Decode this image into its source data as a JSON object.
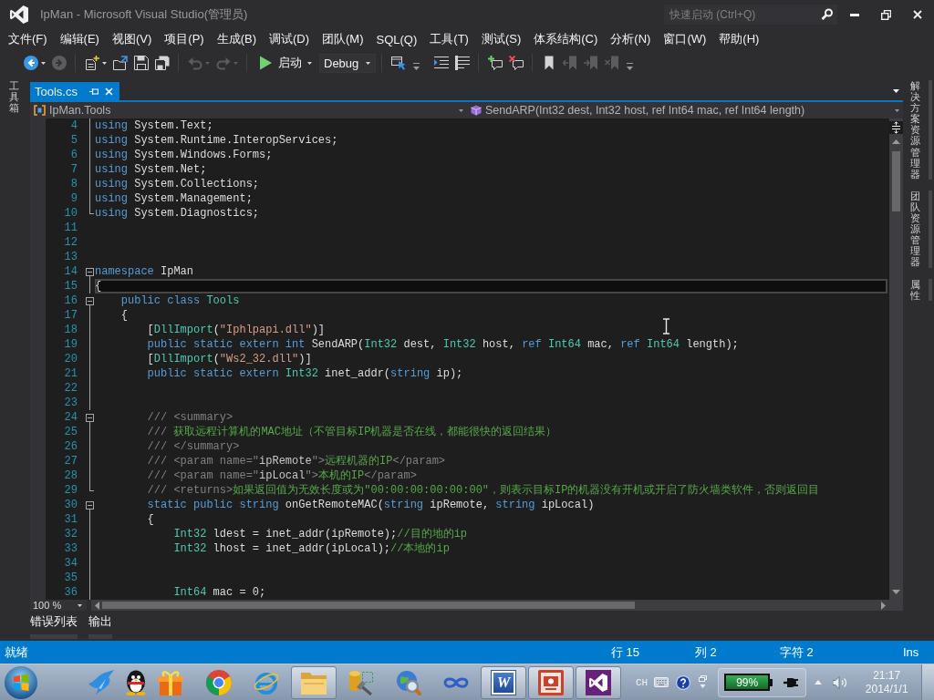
{
  "title_bar": {
    "title": "IpMan - Microsoft Visual Studio(管理员)",
    "quick_launch": {
      "placeholder": "快速启动 (Ctrl+Q)"
    }
  },
  "menu": [
    "文件(F)",
    "编辑(E)",
    "视图(V)",
    "项目(P)",
    "生成(B)",
    "调试(D)",
    "团队(M)",
    "SQL(Q)",
    "工具(T)",
    "测试(S)",
    "体系结构(C)",
    "分析(N)",
    "窗口(W)",
    "帮助(H)"
  ],
  "toolbars": [
    {
      "groups": [
        [
          {
            "kind": "back",
            "disabled": false,
            "dropdown": true
          },
          {
            "kind": "forward",
            "disabled": true,
            "dropdown": false
          }
        ],
        [
          {
            "kind": "new",
            "disabled": false,
            "dropdown": true
          },
          {
            "kind": "open",
            "disabled": false,
            "dropdown": false
          },
          {
            "kind": "save",
            "disabled": false,
            "dropdown": false
          },
          {
            "kind": "saveall",
            "disabled": false,
            "dropdown": false
          }
        ],
        [
          {
            "kind": "undo",
            "disabled": true,
            "dropdown": true
          },
          {
            "kind": "redo",
            "disabled": true,
            "dropdown": true
          }
        ],
        [
          {
            "kind": "run",
            "label": "启动",
            "disabled": false,
            "dropdown": true
          },
          {
            "kind": "combo",
            "value": "Debug",
            "disabled": false,
            "dropdown": true
          }
        ],
        [
          {
            "kind": "attach",
            "disabled": false,
            "dropdown": false
          }
        ]
      ]
    },
    {
      "groups": [
        [
          {
            "kind": "indent",
            "disabled": false,
            "dropdown": false
          },
          {
            "kind": "outdent",
            "disabled": false,
            "dropdown": false
          }
        ],
        [
          {
            "kind": "comment",
            "disabled": false,
            "dropdown": false
          },
          {
            "kind": "uncomment",
            "disabled": false,
            "dropdown": false
          }
        ],
        [
          {
            "kind": "bookmark",
            "disabled": false,
            "dropdown": false
          },
          {
            "kind": "prevmark",
            "disabled": true,
            "dropdown": false
          },
          {
            "kind": "nextmark",
            "disabled": true,
            "dropdown": false
          },
          {
            "kind": "clearmark",
            "disabled": true,
            "dropdown": false
          }
        ]
      ]
    }
  ],
  "left_tabs": [
    "工具箱"
  ],
  "document_tabs": [
    {
      "label": "Tools.cs",
      "selected": true
    }
  ],
  "navigation": {
    "type": "IpMan.Tools",
    "member": "SendARP(Int32 dest, Int32 host, ref Int64 mac, ref Int64 length)"
  },
  "editor": {
    "lines": [
      {
        "number": "4",
        "kind": "inside",
        "current": false,
        "tokens": [
          {
            "kind": "keyword",
            "text": "using"
          },
          {
            "kind": "plain",
            "text": " System.Text;"
          }
        ]
      },
      {
        "number": "5",
        "kind": "inside",
        "current": false,
        "tokens": [
          {
            "kind": "keyword",
            "text": "using"
          },
          {
            "kind": "plain",
            "text": " System.Runtime.InteropServices;"
          }
        ]
      },
      {
        "number": "6",
        "kind": "inside",
        "current": false,
        "tokens": [
          {
            "kind": "keyword",
            "text": "using"
          },
          {
            "kind": "plain",
            "text": " System.Windows.Forms;"
          }
        ]
      },
      {
        "number": "7",
        "kind": "inside",
        "current": false,
        "tokens": [
          {
            "kind": "keyword",
            "text": "using"
          },
          {
            "kind": "plain",
            "text": " System.Net;"
          }
        ]
      },
      {
        "number": "8",
        "kind": "inside",
        "current": false,
        "tokens": [
          {
            "kind": "keyword",
            "text": "using"
          },
          {
            "kind": "plain",
            "text": " System.Collections;"
          }
        ]
      },
      {
        "number": "9",
        "kind": "inside",
        "current": false,
        "tokens": [
          {
            "kind": "keyword",
            "text": "using"
          },
          {
            "kind": "plain",
            "text": " System.Management;"
          }
        ]
      },
      {
        "number": "10",
        "kind": "end",
        "current": false,
        "tokens": [
          {
            "kind": "keyword",
            "text": "using"
          },
          {
            "kind": "plain",
            "text": " System.Diagnostics;"
          }
        ]
      },
      {
        "number": "11",
        "kind": "outside",
        "current": false
      },
      {
        "number": "12",
        "kind": "outside",
        "current": false
      },
      {
        "number": "13",
        "kind": "outside",
        "current": false
      },
      {
        "number": "14",
        "kind": "start",
        "current": false,
        "tokens": [
          {
            "kind": "keyword",
            "text": "namespace"
          },
          {
            "kind": "plain",
            "text": " IpMan"
          }
        ]
      },
      {
        "number": "15",
        "kind": "inside",
        "current": true,
        "tokens": [
          {
            "kind": "plain",
            "text": "{"
          }
        ]
      },
      {
        "number": "16",
        "kind": "start",
        "current": false,
        "tokens": [
          {
            "kind": "keyword",
            "text": "    public class"
          },
          {
            "kind": "type",
            "text": " Tools"
          }
        ]
      },
      {
        "number": "17",
        "kind": "inside",
        "current": false,
        "tokens": [
          {
            "kind": "plain",
            "text": "    {"
          }
        ]
      },
      {
        "number": "18",
        "kind": "inside",
        "current": false,
        "tokens": [
          {
            "kind": "plain",
            "text": "        ["
          },
          {
            "kind": "type",
            "text": "DllImport"
          },
          {
            "kind": "plain",
            "text": "("
          },
          {
            "kind": "string",
            "text": "\"Iphlpapi.dll\""
          },
          {
            "kind": "plain",
            "text": ")]"
          }
        ]
      },
      {
        "number": "19",
        "kind": "inside",
        "current": false,
        "tokens": [
          {
            "kind": "keyword",
            "text": "        public static extern int"
          },
          {
            "kind": "plain",
            "text": " SendARP("
          },
          {
            "kind": "type",
            "text": "Int32"
          },
          {
            "kind": "plain",
            "text": " dest, "
          },
          {
            "kind": "type",
            "text": "Int32"
          },
          {
            "kind": "plain",
            "text": " host, "
          },
          {
            "kind": "keyword",
            "text": "ref"
          },
          {
            "kind": "type",
            "text": " Int64"
          },
          {
            "kind": "plain",
            "text": " mac, "
          },
          {
            "kind": "keyword",
            "text": "ref"
          },
          {
            "kind": "type",
            "text": " Int64"
          },
          {
            "kind": "plain",
            "text": " length);"
          }
        ]
      },
      {
        "number": "20",
        "kind": "inside",
        "current": false,
        "tokens": [
          {
            "kind": "plain",
            "text": "        ["
          },
          {
            "kind": "type",
            "text": "DllImport"
          },
          {
            "kind": "plain",
            "text": "("
          },
          {
            "kind": "string",
            "text": "\"Ws2_32.dll\""
          },
          {
            "kind": "plain",
            "text": ")]"
          }
        ]
      },
      {
        "number": "21",
        "kind": "inside",
        "current": false,
        "tokens": [
          {
            "kind": "keyword",
            "text": "        public static extern"
          },
          {
            "kind": "type",
            "text": " Int32"
          },
          {
            "kind": "plain",
            "text": " inet_addr("
          },
          {
            "kind": "keyword",
            "text": "string"
          },
          {
            "kind": "plain",
            "text": " ip);"
          }
        ]
      },
      {
        "number": "22",
        "kind": "inside",
        "current": false
      },
      {
        "number": "23",
        "kind": "inside",
        "current": false
      },
      {
        "number": "24",
        "kind": "start",
        "current": false,
        "tokens": [
          {
            "kind": "doc",
            "text": "        /// <summary>"
          }
        ]
      },
      {
        "number": "25",
        "kind": "inside",
        "current": false,
        "tokens": [
          {
            "kind": "doc",
            "text": "        ///"
          },
          {
            "kind": "comment",
            "text": " 获取远程计算机的MAC地址（不管目标IP机器是否在线，都能很快的返回结果）"
          }
        ]
      },
      {
        "number": "26",
        "kind": "inside",
        "current": false,
        "tokens": [
          {
            "kind": "doc",
            "text": "        /// </summary>"
          }
        ]
      },
      {
        "number": "27",
        "kind": "inside",
        "current": false,
        "tokens": [
          {
            "kind": "doc",
            "text": "        /// <param name=\""
          },
          {
            "kind": "docvalue",
            "text": "ipRemote"
          },
          {
            "kind": "doc",
            "text": "\">"
          },
          {
            "kind": "comment",
            "text": "远程机器的IP"
          },
          {
            "kind": "doc",
            "text": "</param>"
          }
        ]
      },
      {
        "number": "28",
        "kind": "inside",
        "current": false,
        "tokens": [
          {
            "kind": "doc",
            "text": "        /// <param name=\""
          },
          {
            "kind": "docvalue",
            "text": "ipLocal"
          },
          {
            "kind": "doc",
            "text": "\">"
          },
          {
            "kind": "comment",
            "text": "本机的IP"
          },
          {
            "kind": "doc",
            "text": "</param>"
          }
        ]
      },
      {
        "number": "29",
        "kind": "end",
        "current": false,
        "tokens": [
          {
            "kind": "doc",
            "text": "        /// <returns>"
          },
          {
            "kind": "comment",
            "text": "如果返回值为无效长度或为\"00:00:00:00:00:00\"，则表示目标IP的机器没有开机或开启了防火墙类软件，否则返回目"
          }
        ]
      },
      {
        "number": "30",
        "kind": "start",
        "current": false,
        "tokens": [
          {
            "kind": "keyword",
            "text": "        static public string"
          },
          {
            "kind": "plain",
            "text": " onGetRemoteMAC("
          },
          {
            "kind": "keyword",
            "text": "string"
          },
          {
            "kind": "plain",
            "text": " ipRemote, "
          },
          {
            "kind": "keyword",
            "text": "string"
          },
          {
            "kind": "plain",
            "text": " ipLocal)"
          }
        ]
      },
      {
        "number": "31",
        "kind": "inside",
        "current": false,
        "tokens": [
          {
            "kind": "plain",
            "text": "        {"
          }
        ]
      },
      {
        "number": "32",
        "kind": "inside",
        "current": false,
        "tokens": [
          {
            "kind": "type",
            "text": "            Int32"
          },
          {
            "kind": "plain",
            "text": " ldest = inet_addr(ipRemote);"
          },
          {
            "kind": "comment",
            "text": "//目的地的ip"
          }
        ]
      },
      {
        "number": "33",
        "kind": "inside",
        "current": false,
        "tokens": [
          {
            "kind": "type",
            "text": "            Int32"
          },
          {
            "kind": "plain",
            "text": " lhost = inet_addr(ipLocal);"
          },
          {
            "kind": "comment",
            "text": "//本地的ip"
          }
        ]
      },
      {
        "number": "34",
        "kind": "inside",
        "current": false
      },
      {
        "number": "35",
        "kind": "inside",
        "current": false
      },
      {
        "number": "36",
        "kind": "inside",
        "current": false,
        "tokens": [
          {
            "kind": "type",
            "text": "            Int64"
          },
          {
            "kind": "plain",
            "text": " mac = 0;"
          }
        ]
      }
    ],
    "zoom": "100 %"
  },
  "panel_tabs": [
    "错误列表",
    "输出"
  ],
  "right_tabs": [
    "解决方案资源管理器",
    "团队资源管理器",
    "属性"
  ],
  "status_bar": {
    "message": "就绪",
    "line": "行 15",
    "column": "列 2",
    "character": "字符 2",
    "mode": "Ins"
  },
  "taskbar": {
    "pinned": [
      {
        "kind": "bird"
      },
      {
        "kind": "penguin"
      },
      {
        "kind": "gift"
      }
    ],
    "apps": [
      {
        "kind": "ball",
        "running": false
      },
      {
        "kind": "globe",
        "running": false
      },
      {
        "kind": "folder",
        "running": true
      },
      {
        "kind": "tools",
        "running": false
      },
      {
        "kind": "magnifier",
        "running": false
      },
      {
        "kind": "infinity",
        "running": false
      },
      {
        "kind": "letter",
        "letter": "W",
        "running": true
      },
      {
        "kind": "slides",
        "running": true
      },
      {
        "kind": "ribbon",
        "running": true
      }
    ],
    "tray": {
      "language": "CH",
      "battery": "99%",
      "time": "21:17",
      "date": "2014/1/1"
    }
  }
}
